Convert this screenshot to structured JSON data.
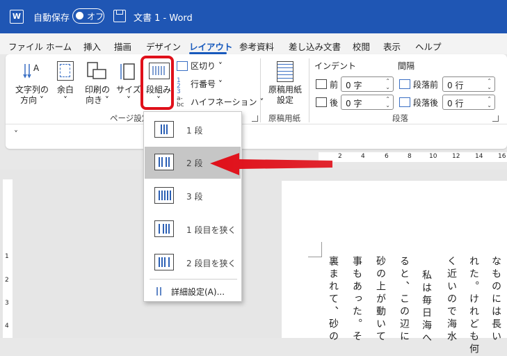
{
  "titlebar": {
    "autosave_label": "自動保存",
    "toggle_label": "オフ",
    "doc_title": "文書 1 - Word",
    "logo": "W"
  },
  "tabs": [
    "ファイル",
    "ホーム",
    "挿入",
    "描画",
    "デザイン",
    "レイアウト",
    "参考資料",
    "差し込み文書",
    "校閲",
    "表示",
    "ヘルプ"
  ],
  "active_tab": "レイアウト",
  "ribbon": {
    "page_setup": {
      "text_direction": "文字列の\n方向 ˅",
      "margins": "余白\n˅",
      "orientation": "印刷の\n向き ˅",
      "size": "サイズ\n˅",
      "columns": "段組み\n˅",
      "breaks": "区切り ˅",
      "line_numbers": "行番号 ˅",
      "hyphenation": "ハイフネーション ˅",
      "group_label": "ページ設定"
    },
    "manuscript": {
      "button": "原稿用紙\n設定",
      "group_label": "原稿用紙"
    },
    "paragraph": {
      "indent_header": "インデント",
      "spacing_header": "間隔",
      "before_indent_label": "前",
      "after_indent_label": "後",
      "before_indent_value": "0 字",
      "after_indent_value": "0 字",
      "space_before_label": "段落前",
      "space_after_label": "段落後",
      "space_before_value": "0 行",
      "space_after_value": "0 行",
      "group_label": "段落"
    }
  },
  "qat_chevron": "˅",
  "dropdown": {
    "items": [
      {
        "label": "1 段",
        "cols": 1,
        "selected": false
      },
      {
        "label": "2 段",
        "cols": 2,
        "selected": true
      },
      {
        "label": "3 段",
        "cols": 3,
        "selected": false
      },
      {
        "label": "1 段目を狭く",
        "cols": 2,
        "selected": false
      },
      {
        "label": "2 段目を狭く",
        "cols": 2,
        "selected": false
      }
    ],
    "more": "詳細設定(A)..."
  },
  "ruler_top": [
    "2",
    "4",
    "6",
    "8",
    "10",
    "12",
    "14",
    "16"
  ],
  "ruler_left": [
    "1",
    "2",
    "3",
    "4"
  ],
  "document_columns": [
    "なものには長い",
    "れた。けれども何",
    "く近いので海水",
    "私は毎日海へ",
    "ると、この辺に",
    "砂の上が動いて",
    "事もあった。そ",
    "裏まれて、砂の"
  ],
  "colors": {
    "titlebar": "#1f56b4",
    "accent": "#185abd",
    "annotation": "#e0101a"
  }
}
